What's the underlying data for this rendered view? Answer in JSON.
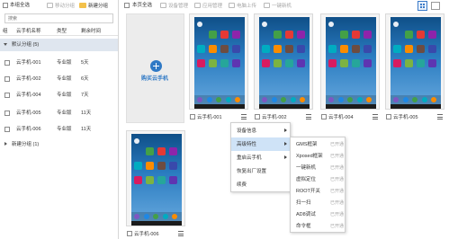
{
  "toolbar_left": {
    "select_all_label": "本组全选",
    "move_group_label": "移动分组",
    "new_group_label": "新建分组"
  },
  "search": {
    "placeholder": "搜索"
  },
  "table": {
    "col_group": "组",
    "col_name": "云手机名称",
    "col_type": "类型",
    "col_remaining": "剩余时间",
    "default_group_label": "默认分组 (5)",
    "rows": [
      {
        "name": "云手机-001",
        "type": "专业版",
        "remaining": "5天"
      },
      {
        "name": "云手机-002",
        "type": "专业版",
        "remaining": "6天"
      },
      {
        "name": "云手机-004",
        "type": "专业版",
        "remaining": "7天"
      },
      {
        "name": "云手机-005",
        "type": "专业版",
        "remaining": "11天"
      },
      {
        "name": "云手机-006",
        "type": "专业版",
        "remaining": "11天"
      }
    ],
    "new_group_row_label": "新建分组 (1)"
  },
  "toolbar_right": {
    "select_page_label": "本页全选",
    "buttons": [
      "设备管理",
      "应用管理",
      "电脑上传",
      "一键新机"
    ]
  },
  "buy_card": {
    "label": "购买云手机",
    "accent": "#2f79c5"
  },
  "phones": [
    {
      "name": "云手机-001"
    },
    {
      "name": "云手机-002"
    },
    {
      "name": "云手机-004"
    },
    {
      "name": "云手机-005"
    },
    {
      "name": "云手机-006"
    }
  ],
  "context_menu": {
    "items": [
      "设备信息",
      "高级特性",
      "重启云手机",
      "恢复出厂设置",
      "续费"
    ]
  },
  "submenu": {
    "items": [
      {
        "label": "GMS框架",
        "status": "已开通"
      },
      {
        "label": "Xposed框架",
        "status": "已开通"
      },
      {
        "label": "一键新机",
        "status": "已开通"
      },
      {
        "label": "虚拟定位",
        "status": "已开通"
      },
      {
        "label": "ROOT开关",
        "status": "已开通"
      },
      {
        "label": "扫一扫",
        "status": "已开通"
      },
      {
        "label": "AD8调试",
        "status": "已开通"
      },
      {
        "label": "命令框",
        "status": "已开通"
      }
    ]
  },
  "colors": {
    "selected_row": "#dfe6ef",
    "menu_highlight": "#cfe3f7",
    "wallpaper": "#2a7cc0"
  },
  "icons": [
    "folder-add-icon",
    "move-icon",
    "grid-view-icon",
    "list-view-icon",
    "device-manage-icon",
    "app-manage-icon",
    "upload-icon",
    "new-phone-icon",
    "plus-icon",
    "menu-icon",
    "chevron-right-icon",
    "chevron-down-icon"
  ]
}
